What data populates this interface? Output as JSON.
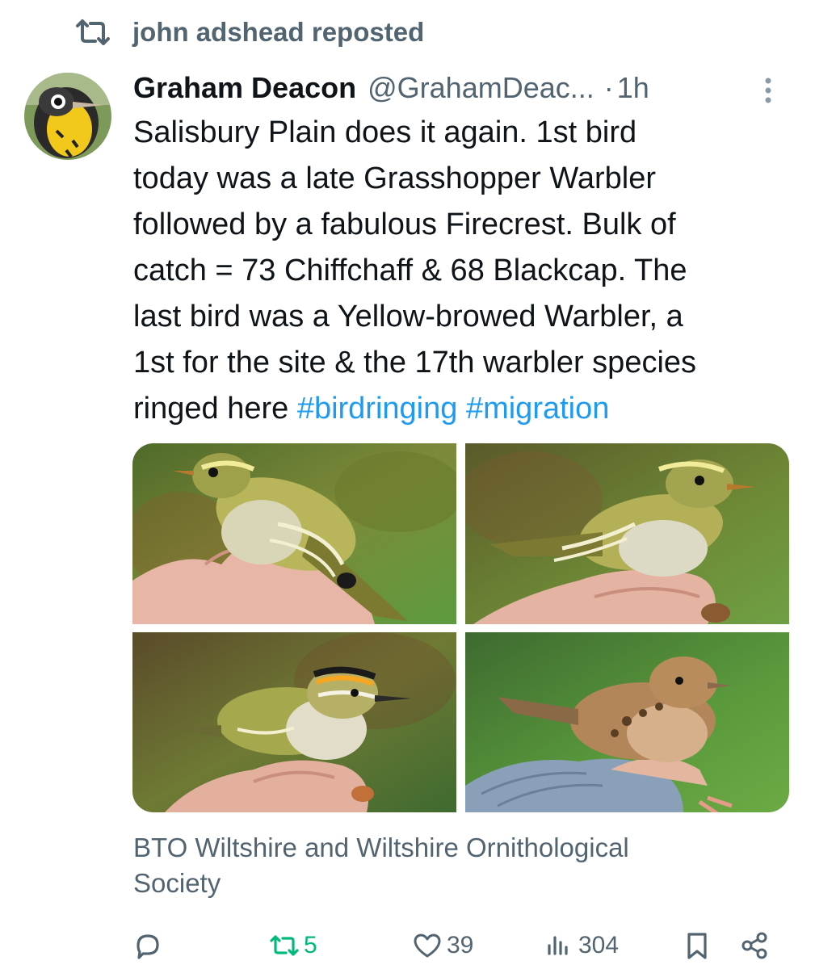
{
  "repost": {
    "text": "john adshead reposted",
    "icon": "repost-icon"
  },
  "author": {
    "name": "Graham Deacon",
    "handle": "@GrahamDeac...",
    "separator": "·",
    "time": "1h"
  },
  "tweet": {
    "lines": [
      "Salisbury Plain does it again. 1st bird",
      "today was a late Grasshopper Warbler",
      "followed by a fabulous Firecrest. Bulk of",
      "catch = 73 Chiffchaff & 68 Blackcap. The",
      "last bird was a Yellow-browed Warbler, a",
      "1st for the site & the 17th warbler species"
    ],
    "last_line_prefix": "ringed here",
    "hashtags": [
      "#birdringing",
      "#migration"
    ]
  },
  "media": {
    "photos": [
      {
        "subject": "yellow-browed-warbler-left"
      },
      {
        "subject": "yellow-browed-warbler-right"
      },
      {
        "subject": "firecrest"
      },
      {
        "subject": "grasshopper-warbler"
      }
    ]
  },
  "caption": {
    "lines": [
      "BTO Wiltshire and Wiltshire Ornithological",
      "Society"
    ]
  },
  "actions": {
    "reply": {
      "icon": "reply-icon",
      "count": ""
    },
    "repost": {
      "icon": "repost-icon",
      "count": "5",
      "color": "#00ba7c"
    },
    "like": {
      "icon": "heart-icon",
      "count": "39"
    },
    "views": {
      "icon": "views-icon",
      "count": "304"
    },
    "bookmark": {
      "icon": "bookmark-icon"
    },
    "share": {
      "icon": "share-icon"
    }
  },
  "colors": {
    "text": "#0f1419",
    "secondary": "#536471",
    "link": "#1d9bf0",
    "repost_active": "#00ba7c"
  }
}
